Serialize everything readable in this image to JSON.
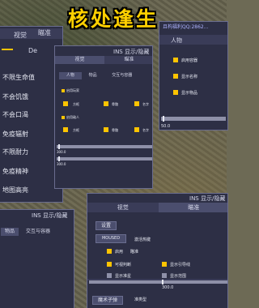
{
  "title": "核处逢生",
  "colors": {
    "accent": "#ffc400",
    "panel": "#2d2f45",
    "tab_active": "#4b4e6e",
    "title": "#ffd000"
  },
  "left_panel": {
    "tabs": [
      "视觉",
      "瞄准"
    ],
    "tab2": "De",
    "items": [
      "不限生命值",
      "不会饥饿",
      "不会口渴",
      "免疫辐射",
      "不限耐力",
      "免疫精神",
      "地图高亮"
    ]
  },
  "top_right": {
    "header": "且构福利QQ:2862...",
    "tab": "人物",
    "items": [
      "启用容器",
      "显示名称",
      "显示物品"
    ],
    "slider_value": "50.0"
  },
  "mid_panel": {
    "header": "INS 显示/隐藏",
    "tabs": [
      "视觉",
      "瞄准"
    ],
    "subtabs": [
      "人物",
      "物品",
      "交互与容器"
    ],
    "enable_human": "启用玩家",
    "row1": [
      "方框",
      "骨骼",
      "名字"
    ],
    "enable_enemy": "启用敌人",
    "row2": [
      "方框",
      "骨骼",
      "名字"
    ],
    "slider1": "300.0",
    "slider2": "300.0"
  },
  "bl_panel": {
    "header": "INS 显示/隐藏",
    "tabs": [
      "物品",
      "交互与容器"
    ]
  },
  "aim_panel": {
    "header": "INS 显示/隐藏",
    "tabs": [
      "视觉",
      "瞄准"
    ],
    "settings": "设置",
    "moused": "MOUSED",
    "hotkey": "激活热键",
    "enable": "启用",
    "aim": "瞄准",
    "visible_check": "可视判断",
    "show_guide": "显示引导线",
    "show_crosshair": "显示准星",
    "show_range": "显示范围",
    "slider_value": "300.0",
    "bullet": "魔术子弹",
    "select": "准类型"
  }
}
